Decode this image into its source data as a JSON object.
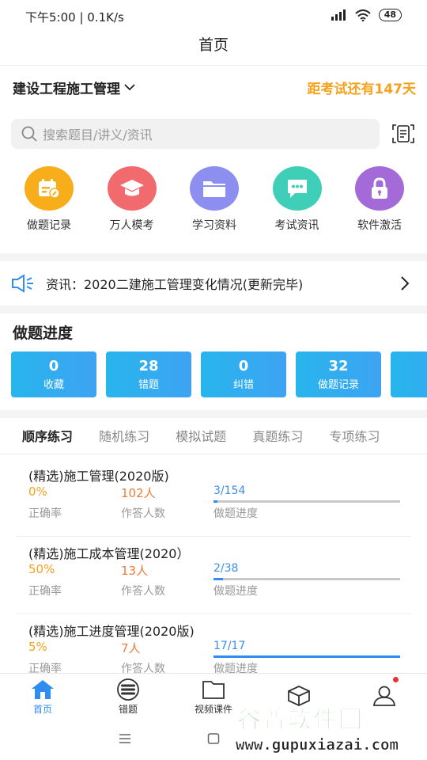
{
  "status_bar": {
    "time_speed": "下午5:00 | 0.1K/s",
    "battery": "48"
  },
  "header": {
    "title": "首页"
  },
  "course": {
    "name": "建设工程施工管理",
    "countdown": "距考试还有147天"
  },
  "search": {
    "placeholder": "搜索题目/讲义/资讯"
  },
  "shortcuts": [
    {
      "label": "做题记录",
      "icon": "calendar-edit-icon",
      "color": "#f7ae1a"
    },
    {
      "label": "万人模考",
      "icon": "graduation-cap-icon",
      "color": "#f06a6e"
    },
    {
      "label": "学习资料",
      "icon": "folder-icon",
      "color": "#8d8ff0"
    },
    {
      "label": "考试资讯",
      "icon": "chat-bubble-icon",
      "color": "#3fcfb9"
    },
    {
      "label": "软件激活",
      "icon": "lock-icon",
      "color": "#a46ad8"
    }
  ],
  "news": {
    "text": "资讯：2020二建施工管理变化情况(更新完毕)"
  },
  "progress": {
    "title": "做题进度",
    "stats": [
      {
        "value": "0",
        "label": "收藏"
      },
      {
        "value": "28",
        "label": "错题"
      },
      {
        "value": "0",
        "label": "纠错"
      },
      {
        "value": "32",
        "label": "做题记录"
      },
      {
        "value": "",
        "label": ""
      }
    ]
  },
  "tabs": [
    "顺序练习",
    "随机练习",
    "模拟试题",
    "真题练习",
    "专项练习"
  ],
  "papers": [
    {
      "title": "(精选)施工管理(2020版)",
      "accuracy": "0%",
      "people": "102人",
      "progress": "3/154",
      "progress_fraction": 0.0195
    },
    {
      "title": "(精选)施工成本管理(2020）",
      "accuracy": "50%",
      "people": "13人",
      "progress": "2/38",
      "progress_fraction": 0.0526
    },
    {
      "title": "(精选)施工进度管理(2020版)",
      "accuracy": "5%",
      "people": "7人",
      "progress": "17/17",
      "progress_fraction": 1.0
    }
  ],
  "paper_labels": {
    "accuracy": "正确率",
    "people": "作答人数",
    "progress": "做题进度"
  },
  "bottom_nav": [
    {
      "label": "首页",
      "icon": "home-icon",
      "active": true
    },
    {
      "label": "错题",
      "icon": "list-icon",
      "active": false
    },
    {
      "label": "视频课件",
      "icon": "video-folder-icon",
      "active": false
    },
    {
      "label": "",
      "icon": "cube-icon",
      "active": false
    },
    {
      "label": "",
      "icon": "user-icon",
      "active": false
    }
  ],
  "watermark": {
    "title": "谷普软件园",
    "url": "www.gupuxiazai.com"
  },
  "colors": {
    "accent": "#2f8cf0",
    "countdown": "#f5a11c",
    "card": "#2db0ee"
  }
}
